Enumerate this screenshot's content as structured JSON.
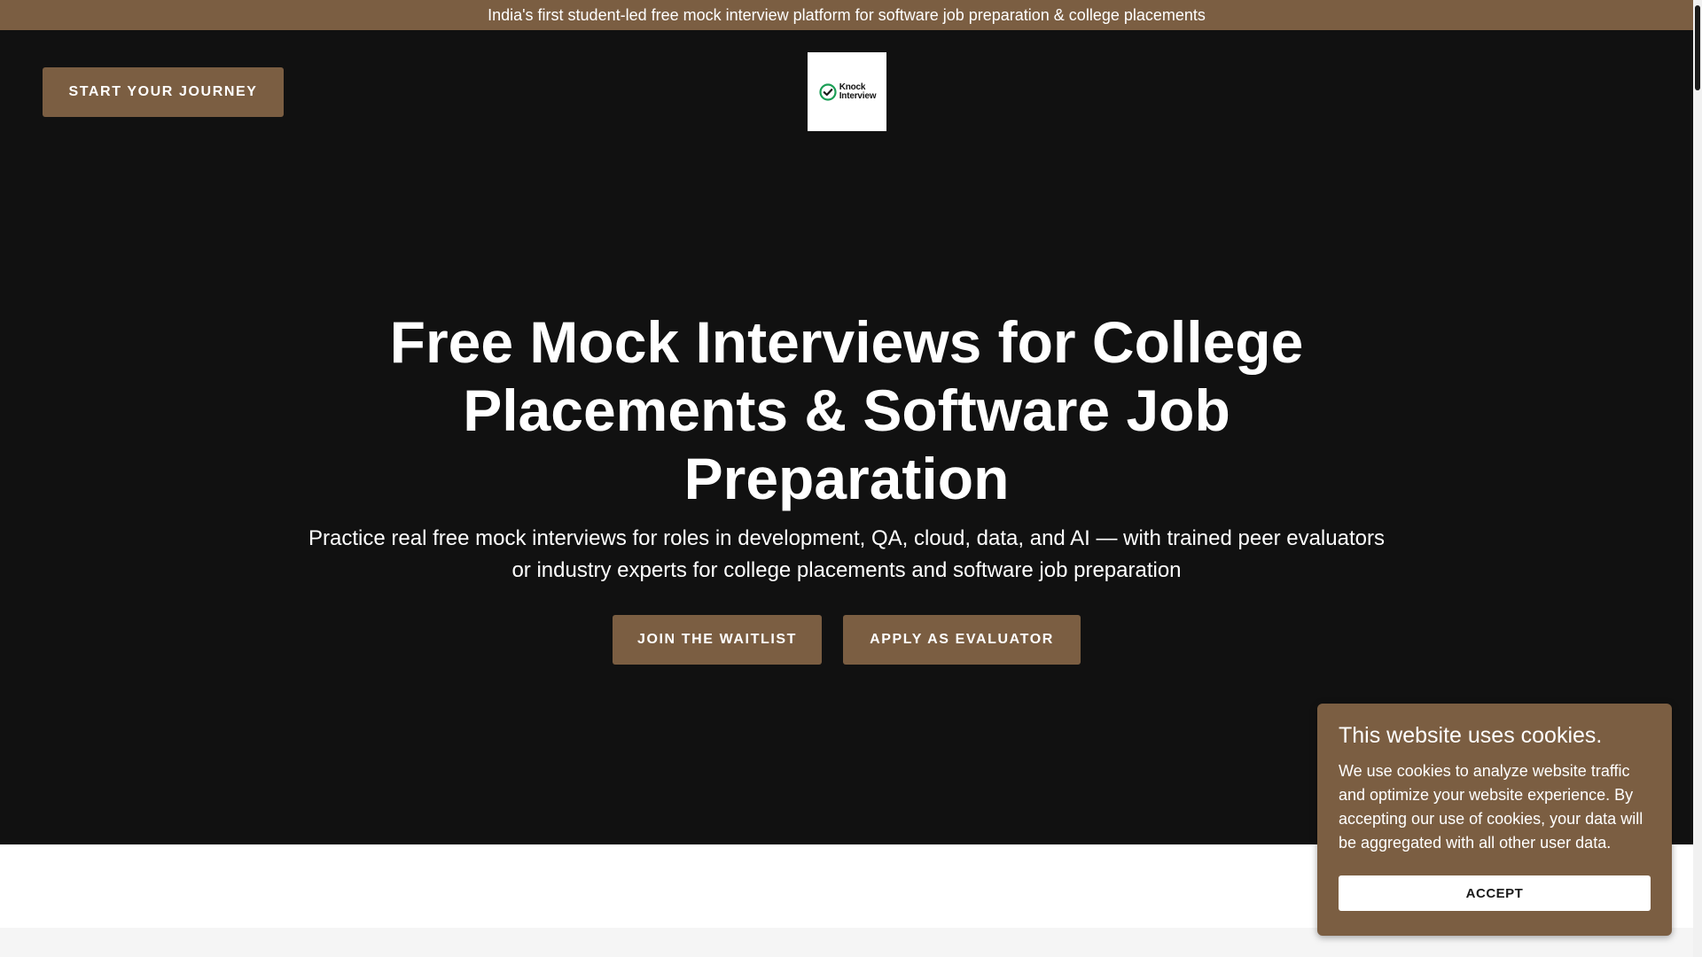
{
  "announcement": "India's first student-led free mock interview platform for software job preparation & college placements",
  "header": {
    "cta_label": "START YOUR JOURNEY",
    "logo": {
      "line1": "Knock",
      "line2": "Interview",
      "icon": "check-circle-icon"
    }
  },
  "hero": {
    "title": "Free Mock Interviews for College Placements & Software Job Preparation",
    "subtitle": "Practice real free mock interviews for roles in development, QA, cloud, data, and AI — with trained peer evaluators or industry experts for college placements and software job preparation",
    "primary_cta": "JOIN THE WAITLIST",
    "secondary_cta": "APPLY AS EVALUATOR"
  },
  "cookie_banner": {
    "title": "This website uses cookies.",
    "text": "We use cookies to analyze website traffic and optimize your website experience. By accepting our use of cookies, your data will be aggregated with all other user data.",
    "accept_label": "ACCEPT"
  },
  "colors": {
    "brand": "#7b5e42",
    "hero_bg": "#111111",
    "logo_check": "#1a9e55"
  }
}
